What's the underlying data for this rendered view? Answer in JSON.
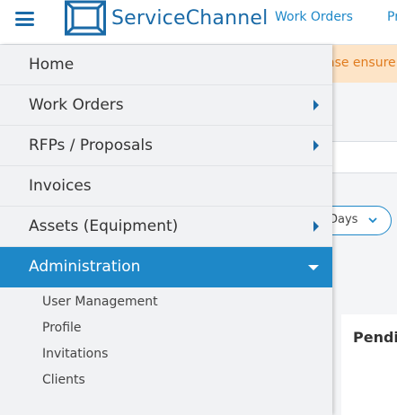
{
  "header": {
    "logo_text": "ServiceChannel",
    "nav": [
      "Work Orders",
      "Pr"
    ]
  },
  "background": {
    "banner_text": "ase ensure",
    "days_label": "Days",
    "pending_title": "Pendin"
  },
  "menu": {
    "items": [
      {
        "label": "Home",
        "has_arrow": false
      },
      {
        "label": "Work Orders",
        "has_arrow": true
      },
      {
        "label": "RFPs / Proposals",
        "has_arrow": true
      },
      {
        "label": "Invoices",
        "has_arrow": false
      },
      {
        "label": "Assets (Equipment)",
        "has_arrow": true
      },
      {
        "label": "Administration",
        "has_arrow": true,
        "expanded": true
      }
    ],
    "subitems": [
      "User Management",
      "Profile",
      "Invitations",
      "Clients"
    ]
  },
  "colors": {
    "brand": "#1a6aa7",
    "accent": "#1e88c8",
    "warning_bg": "#fde4c7",
    "warning_text": "#e07b1e"
  },
  "icons": [
    "menu-icon",
    "servicechannel-logo",
    "chevron-down-icon",
    "caret-right-icon",
    "caret-down-icon"
  ]
}
